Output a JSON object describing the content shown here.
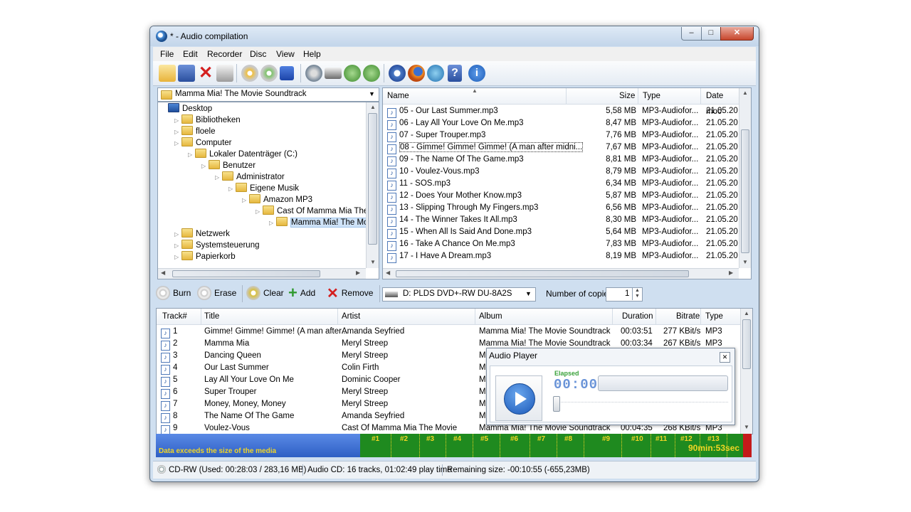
{
  "window": {
    "title": "* - Audio compilation"
  },
  "window_controls": {
    "minimize": "–",
    "maximize": "□",
    "close": "✕"
  },
  "menu": [
    "File",
    "Edit",
    "Recorder",
    "Disc",
    "View",
    "Help"
  ],
  "toolbar_icons": [
    "new-project-icon",
    "save-icon",
    "delete-icon",
    "print-icon",
    "burn-disc-icon",
    "erase-disc-icon",
    "blue-square-icon",
    "disc-info-icon",
    "drive-icon",
    "download-icon",
    "upload-icon",
    "settings-gear-icon",
    "firefox-globe-icon",
    "search-globe-icon",
    "help-icon",
    "info-icon"
  ],
  "folder_combo": {
    "value": "Mamma Mia! The Movie Soundtrack"
  },
  "tree": [
    {
      "label": "Desktop",
      "indent": 0,
      "icon": "desktop"
    },
    {
      "label": "Bibliotheken",
      "indent": 1
    },
    {
      "label": "floele",
      "indent": 1
    },
    {
      "label": "Computer",
      "indent": 1
    },
    {
      "label": "Lokaler Datenträger (C:)",
      "indent": 2
    },
    {
      "label": "Benutzer",
      "indent": 3
    },
    {
      "label": "Administrator",
      "indent": 4
    },
    {
      "label": "Eigene Musik",
      "indent": 5
    },
    {
      "label": "Amazon MP3",
      "indent": 6
    },
    {
      "label": "Cast Of Mamma Mia The Mo",
      "indent": 7
    },
    {
      "label": "Mamma Mia! The Movie",
      "indent": 8
    },
    {
      "label": "Netzwerk",
      "indent": 1
    },
    {
      "label": "Systemsteuerung",
      "indent": 1
    },
    {
      "label": "Papierkorb",
      "indent": 1
    }
  ],
  "file_list": {
    "headers": {
      "name": "Name",
      "size": "Size",
      "type": "Type",
      "date": "Date moc"
    },
    "rows": [
      {
        "name": "05 - Our Last Summer.mp3",
        "size": "5,58 MB",
        "type": "MP3-Audiofor...",
        "date": "21.05.20"
      },
      {
        "name": "06 - Lay All Your Love On Me.mp3",
        "size": "8,47 MB",
        "type": "MP3-Audiofor...",
        "date": "21.05.20"
      },
      {
        "name": "07 - Super Trouper.mp3",
        "size": "7,76 MB",
        "type": "MP3-Audiofor...",
        "date": "21.05.20"
      },
      {
        "name": "08 - Gimme! Gimme! Gimme! (A man after midni...",
        "size": "7,67 MB",
        "type": "MP3-Audiofor...",
        "date": "21.05.20"
      },
      {
        "name": "09 - The Name Of The Game.mp3",
        "size": "8,81 MB",
        "type": "MP3-Audiofor...",
        "date": "21.05.20"
      },
      {
        "name": "10 - Voulez-Vous.mp3",
        "size": "8,79 MB",
        "type": "MP3-Audiofor...",
        "date": "21.05.20"
      },
      {
        "name": "11 - SOS.mp3",
        "size": "6,34 MB",
        "type": "MP3-Audiofor...",
        "date": "21.05.20"
      },
      {
        "name": "12 - Does Your Mother Know.mp3",
        "size": "5,87 MB",
        "type": "MP3-Audiofor...",
        "date": "21.05.20"
      },
      {
        "name": "13 - Slipping Through My Fingers.mp3",
        "size": "6,56 MB",
        "type": "MP3-Audiofor...",
        "date": "21.05.20"
      },
      {
        "name": "14 - The Winner Takes It All.mp3",
        "size": "8,30 MB",
        "type": "MP3-Audiofor...",
        "date": "21.05.20"
      },
      {
        "name": "15 - When All Is Said And Done.mp3",
        "size": "5,64 MB",
        "type": "MP3-Audiofor...",
        "date": "21.05.20"
      },
      {
        "name": "16 - Take A Chance On Me.mp3",
        "size": "7,83 MB",
        "type": "MP3-Audiofor...",
        "date": "21.05.20"
      },
      {
        "name": "17 - I Have A Dream.mp3",
        "size": "8,19 MB",
        "type": "MP3-Audiofor...",
        "date": "21.05.20"
      }
    ]
  },
  "actions": {
    "burn": "Burn",
    "erase": "Erase",
    "clear": "Clear",
    "add": "Add",
    "remove": "Remove"
  },
  "drive": {
    "value": "D: PLDS DVD+-RW DU-8A2S"
  },
  "copies": {
    "label": "Number of copies:",
    "value": "1"
  },
  "tracks": {
    "headers": {
      "num": "Track#",
      "title": "Title",
      "artist": "Artist",
      "album": "Album",
      "duration": "Duration",
      "bitrate": "Bitrate",
      "type": "Type"
    },
    "rows": [
      {
        "num": "1",
        "title": "Gimme! Gimme! Gimme! (A man after...",
        "artist": "Amanda Seyfried",
        "album": "Mamma Mia! The Movie Soundtrack",
        "duration": "00:03:51",
        "bitrate": "277 KBit/s",
        "type": "MP3"
      },
      {
        "num": "2",
        "title": "Mamma Mia",
        "artist": "Meryl Streep",
        "album": "Mamma Mia! The Movie Soundtrack",
        "duration": "00:03:34",
        "bitrate": "267 KBit/s",
        "type": "MP3"
      },
      {
        "num": "3",
        "title": "Dancing Queen",
        "artist": "Meryl Streep",
        "album": "M",
        "duration": "",
        "bitrate": "",
        "type": ""
      },
      {
        "num": "4",
        "title": "Our Last Summer",
        "artist": "Colin Firth",
        "album": "M",
        "duration": "",
        "bitrate": "",
        "type": ""
      },
      {
        "num": "5",
        "title": "Lay All Your Love On Me",
        "artist": "Dominic Cooper",
        "album": "M",
        "duration": "",
        "bitrate": "",
        "type": ""
      },
      {
        "num": "6",
        "title": "Super Trouper",
        "artist": "Meryl Streep",
        "album": "M",
        "duration": "",
        "bitrate": "",
        "type": ""
      },
      {
        "num": "7",
        "title": "Money, Money, Money",
        "artist": "Meryl Streep",
        "album": "M",
        "duration": "",
        "bitrate": "",
        "type": ""
      },
      {
        "num": "8",
        "title": "The Name Of The Game",
        "artist": "Amanda Seyfried",
        "album": "M",
        "duration": "",
        "bitrate": "",
        "type": ""
      },
      {
        "num": "9",
        "title": "Voulez-Vous",
        "artist": "Cast Of Mamma Mia The Movie",
        "album": "Mamma Mia! The Movie Soundtrack",
        "duration": "00:04:35",
        "bitrate": "268 KBit/s",
        "type": "MP3"
      }
    ]
  },
  "capacity": {
    "warning": "Data exceeds the size of the media",
    "track_markers": [
      "#1",
      "#2",
      "#3",
      "#4",
      "#5",
      "#6",
      "#7",
      "#8",
      "#9",
      "#10",
      "#11",
      "#12",
      "#13"
    ],
    "total": "90min:53sec",
    "colors": {
      "blue": "#3b6fd4",
      "green": "#1f8a1f",
      "red": "#c41a1a",
      "text": "#f2d624"
    }
  },
  "status": {
    "media": "CD-RW (Used: 00:28:03 / 283,16 MB)",
    "audio": "Audio CD: 16 tracks, 01:02:49 play time",
    "remaining": "Remaining size: -00:10:55 (-655,23MB)"
  },
  "audio_player": {
    "title": "Audio Player",
    "close": "✕",
    "elapsed_label": "Elapsed",
    "elapsed_value": "00:00"
  }
}
